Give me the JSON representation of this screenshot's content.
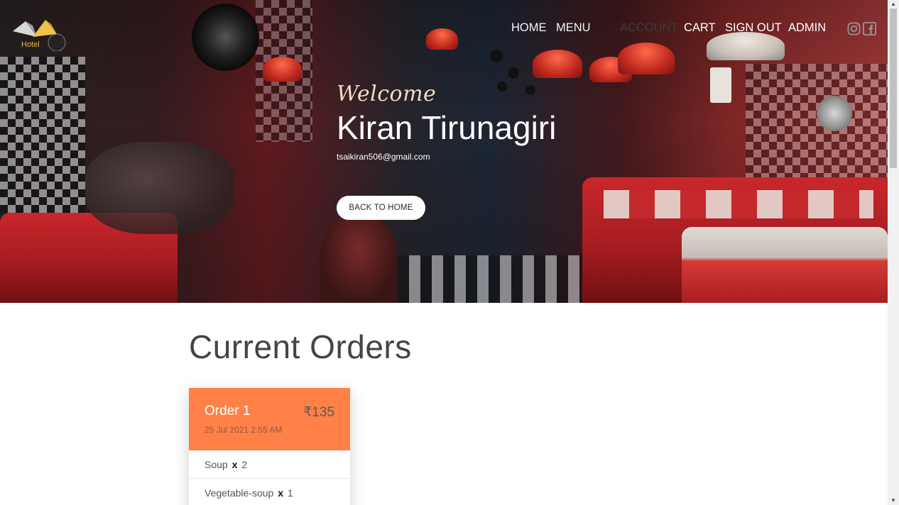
{
  "header": {
    "logo_text": "Hotel",
    "nav": {
      "home": "HOME",
      "menu": "MENU",
      "account": "ACCOUNT",
      "cart": "CART",
      "sign_out": "SIGN OUT",
      "admin": "ADMIN"
    },
    "social": [
      "instagram-icon",
      "facebook-icon"
    ]
  },
  "hero": {
    "welcome": "Welcome",
    "user_name": "Kiran Tirunagiri",
    "user_email": "tsaikiran506@gmail.com",
    "back_button": "BACK TO HOME"
  },
  "orders": {
    "section_title": "Current Orders",
    "list": [
      {
        "title": "Order 1",
        "total": "₹135",
        "date": "25 Jul 2021 2:55 AM",
        "items": [
          {
            "name": "Soup",
            "x": "x",
            "qty": "2"
          },
          {
            "name": "Vegetable-soup",
            "x": "x",
            "qty": "1"
          }
        ]
      }
    ]
  },
  "colors": {
    "order_header": "#ff8147",
    "text_dark": "#444444",
    "hero_accent": "#c9272b"
  }
}
